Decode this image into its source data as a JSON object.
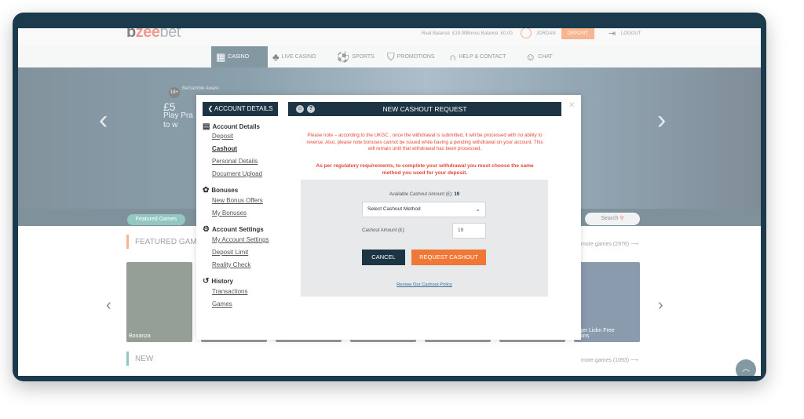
{
  "header": {
    "logo": {
      "part1": "b",
      "part2": "zee",
      "part3": "bet"
    },
    "real_balance": "Real Balance: £19.00",
    "bonus_balance": "Bonus Balance: £0.00",
    "username": "JORDAN",
    "deposit_label": "DEPOSIT",
    "logout_label": "LOGOUT"
  },
  "nav": {
    "items": [
      {
        "label": "CASINO",
        "icon": "slot-machine-icon"
      },
      {
        "label": "LIVE CASINO",
        "icon": "live-casino-icon"
      },
      {
        "label": "SPORTS",
        "icon": "soccer-ball-icon"
      },
      {
        "label": "PROMOTIONS",
        "icon": "shopping-bag-icon"
      },
      {
        "label": "HELP & CONTACT",
        "icon": "headset-icon"
      },
      {
        "label": "CHAT",
        "icon": "chat-icon"
      }
    ]
  },
  "banner": {
    "age_badge": "18+",
    "badge_text": "BeGamble Aware",
    "line1": "£5",
    "line2": "Play Pra",
    "line3": "to w"
  },
  "filters": {
    "featured_chip": "Featured Games",
    "search_label": "Search"
  },
  "sections": {
    "featured_title": "FEATURED GAM",
    "featured_more": "more games (2976) ⟶",
    "new_title": "NEW",
    "new_more": "more games (1093) ⟶",
    "tiles": [
      "Bonanza",
      "",
      "",
      "",
      "",
      "",
      "nger Lickn Free\nspins"
    ]
  },
  "modal": {
    "back_label": "ACCOUNT DETAILS",
    "menu": {
      "account_details": "Account Details",
      "deposit": "Deposit",
      "cashout": "Cashout",
      "personal_details": "Personal Details",
      "document_upload": "Document Upload",
      "bonuses": "Bonuses",
      "new_bonus_offers": "New Bonus Offers",
      "my_bonuses": "My Bonuses",
      "account_settings": "Account Settings",
      "my_account_settings": "My Account Settings",
      "deposit_limit": "Deposit Limit",
      "reality_check": "Reality Check",
      "history": "History",
      "transactions": "Transactions",
      "games": "Games"
    },
    "title": "NEW CASHOUT REQUEST",
    "note1": "Please note – according to the UKGC , once the withdrawal is submitted, it will be processed with no ability to reverse. Also, please note bonuses cannot be issued while having a pending withdrawal on your account. This will remain until that withdrawal has been processed.",
    "note2": "As per regulatory requirements, to complete your withdrawal you must choose the same method you used for your deposit.",
    "available_label": "Available Cashout Amount (£):",
    "available_value": "19",
    "method_placeholder": "Select Cashout Method",
    "amount_label": "Cashout Amount (£):",
    "amount_value": "19",
    "cancel_label": "CANCEL",
    "request_label": "REQUEST CASHOUT",
    "policy_link": "Review Our Cashout Policy"
  }
}
